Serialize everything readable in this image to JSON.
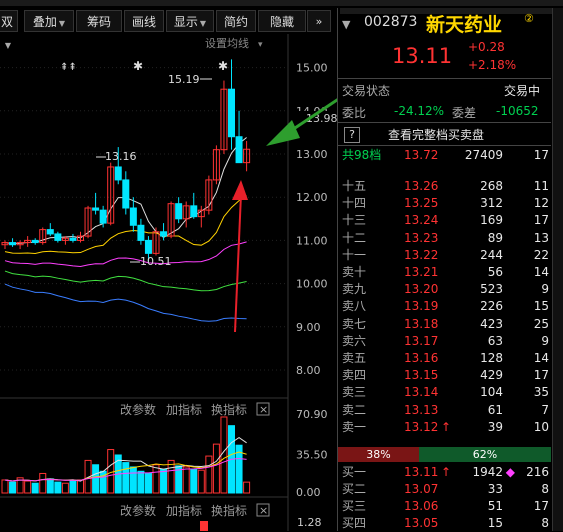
{
  "toolbar": {
    "items": [
      {
        "label": "叠加",
        "dropdown": true
      },
      {
        "label": "筹码",
        "dropdown": false
      },
      {
        "label": "画线",
        "dropdown": false
      },
      {
        "label": "显示",
        "dropdown": true
      },
      {
        "label": "简约",
        "dropdown": false
      },
      {
        "label": "隐藏",
        "dropdown": false
      }
    ],
    "first_partial": "双",
    "more_icon": "chevron-right-double-icon",
    "dropdown_arrow": "▼"
  },
  "chart": {
    "settings_label": "设置均线",
    "settings_arrow": "▾",
    "high_annot": "15.19",
    "mid_annot": "13.16",
    "low_annot": "10.51",
    "current_price_tag": "13.98",
    "price_axis": [
      "15.00",
      "14.00",
      "13.00",
      "12.00",
      "11.00",
      "10.00",
      "9.00",
      "8.00"
    ],
    "vol_axis": [
      "70.90",
      "35.50",
      "0.00"
    ],
    "sub_axis": [
      "1.28"
    ],
    "panel_buttons": [
      "改参数",
      "加指标",
      "换指标"
    ],
    "close_glyph": "×",
    "up_color": "#ff3333",
    "down_color": "#00e5ff",
    "annotation_arrow_color": "#2e9e2e",
    "marker_arrow_color": "#e8202a"
  },
  "chart_data": {
    "type": "candlestick",
    "ohlc": [
      [
        10.9,
        11.0,
        10.8,
        10.95
      ],
      [
        10.95,
        11.05,
        10.85,
        10.9
      ],
      [
        10.9,
        11.0,
        10.8,
        10.95
      ],
      [
        10.95,
        11.1,
        10.85,
        11.0
      ],
      [
        11.0,
        11.05,
        10.9,
        10.95
      ],
      [
        10.95,
        11.3,
        10.9,
        11.25
      ],
      [
        11.25,
        11.4,
        11.1,
        11.15
      ],
      [
        11.15,
        11.2,
        10.95,
        11.0
      ],
      [
        11.0,
        11.1,
        10.9,
        11.05
      ],
      [
        11.05,
        11.15,
        10.95,
        11.0
      ],
      [
        11.0,
        11.2,
        10.95,
        11.1
      ],
      [
        11.1,
        11.8,
        11.05,
        11.75
      ],
      [
        11.75,
        12.1,
        11.6,
        11.7
      ],
      [
        11.7,
        11.8,
        11.3,
        11.4
      ],
      [
        11.4,
        12.8,
        11.35,
        12.7
      ],
      [
        12.7,
        13.16,
        12.3,
        12.4
      ],
      [
        12.4,
        12.6,
        11.6,
        11.75
      ],
      [
        11.75,
        12.0,
        11.2,
        11.35
      ],
      [
        11.35,
        11.5,
        10.9,
        11.0
      ],
      [
        11.0,
        11.1,
        10.51,
        10.7
      ],
      [
        10.7,
        11.3,
        10.65,
        11.2
      ],
      [
        11.2,
        11.4,
        11.0,
        11.1
      ],
      [
        11.1,
        11.9,
        11.05,
        11.85
      ],
      [
        11.85,
        12.0,
        11.4,
        11.5
      ],
      [
        11.5,
        11.9,
        11.3,
        11.8
      ],
      [
        11.8,
        12.1,
        11.5,
        11.55
      ],
      [
        11.55,
        11.8,
        11.3,
        11.7
      ],
      [
        11.7,
        12.5,
        11.6,
        12.4
      ],
      [
        12.4,
        13.2,
        12.3,
        13.1
      ],
      [
        13.1,
        14.7,
        13.0,
        14.5
      ],
      [
        14.5,
        15.19,
        13.1,
        13.4
      ],
      [
        13.4,
        14.0,
        13.0,
        12.8
      ],
      [
        12.8,
        13.3,
        12.6,
        13.11
      ]
    ],
    "volume": [
      12,
      10,
      14,
      11,
      9,
      18,
      13,
      10,
      9,
      11,
      12,
      30,
      26,
      20,
      40,
      35,
      28,
      24,
      20,
      18,
      26,
      22,
      30,
      25,
      24,
      22,
      21,
      34,
      45,
      70,
      62,
      44,
      10
    ],
    "volume_up": [
      1,
      0,
      1,
      1,
      0,
      1,
      0,
      0,
      1,
      0,
      1,
      1,
      0,
      0,
      1,
      0,
      0,
      0,
      0,
      0,
      1,
      0,
      1,
      0,
      1,
      0,
      1,
      1,
      1,
      1,
      0,
      0,
      1
    ],
    "price_range": [
      8.0,
      15.5
    ],
    "volume_range": [
      0,
      70.9
    ]
  },
  "quote": {
    "code": "002873",
    "name": "新天药业",
    "badge": "②",
    "price": "13.11",
    "change": "+0.28",
    "change_pct": "+2.18%",
    "status_label": "交易状态",
    "status_value": "交易中",
    "weibi_label": "委比",
    "weibi_value": "-24.12%",
    "weicha_label": "委差",
    "weicha_value": "-10652",
    "help_glyph": "?",
    "full_orderbook_btn": "查看完整档买卖盘",
    "total_label": "共98档",
    "total_price": "13.72",
    "total_vol": "27409",
    "total_count": "17",
    "asks": [
      {
        "label": "十五",
        "price": "13.26",
        "vol": "268",
        "count": "11"
      },
      {
        "label": "十四",
        "price": "13.25",
        "vol": "312",
        "count": "12"
      },
      {
        "label": "十三",
        "price": "13.24",
        "vol": "169",
        "count": "17"
      },
      {
        "label": "十二",
        "price": "13.23",
        "vol": "89",
        "count": "13"
      },
      {
        "label": "十一",
        "price": "13.22",
        "vol": "244",
        "count": "22"
      },
      {
        "label": "卖十",
        "price": "13.21",
        "vol": "56",
        "count": "14"
      },
      {
        "label": "卖九",
        "price": "13.20",
        "vol": "523",
        "count": "9"
      },
      {
        "label": "卖八",
        "price": "13.19",
        "vol": "226",
        "count": "15"
      },
      {
        "label": "卖七",
        "price": "13.18",
        "vol": "423",
        "count": "25"
      },
      {
        "label": "卖六",
        "price": "13.17",
        "vol": "63",
        "count": "9"
      },
      {
        "label": "卖五",
        "price": "13.16",
        "vol": "128",
        "count": "14"
      },
      {
        "label": "卖四",
        "price": "13.15",
        "vol": "429",
        "count": "17"
      },
      {
        "label": "卖三",
        "price": "13.14",
        "vol": "104",
        "count": "35"
      },
      {
        "label": "卖二",
        "price": "13.13",
        "vol": "61",
        "count": "7"
      },
      {
        "label": "卖一",
        "price": "13.12",
        "vol": "39",
        "count": "10"
      }
    ],
    "ratio_sell": "38%",
    "ratio_buy": "62%",
    "bids": [
      {
        "label": "买一",
        "price": "13.11",
        "vol": "1942",
        "count": "216"
      },
      {
        "label": "买二",
        "price": "13.07",
        "vol": "33",
        "count": "8"
      },
      {
        "label": "买三",
        "price": "13.06",
        "vol": "51",
        "count": "17"
      },
      {
        "label": "买四",
        "price": "13.05",
        "vol": "15",
        "count": "8"
      }
    ],
    "up_arrow": "↑"
  }
}
